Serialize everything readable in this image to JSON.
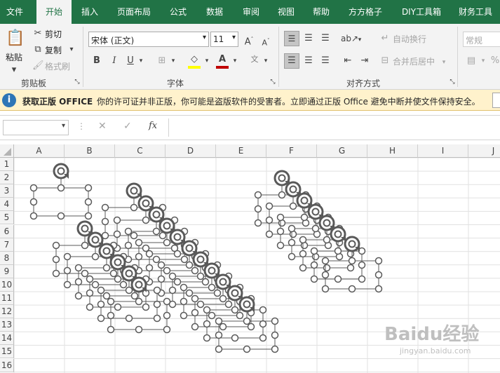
{
  "tabs": [
    "文件",
    "开始",
    "插入",
    "页面布局",
    "公式",
    "数据",
    "审阅",
    "视图",
    "帮助",
    "方方格子",
    "DIY工具箱",
    "财务工具"
  ],
  "active_tab": "开始",
  "clipboard": {
    "paste": "粘贴",
    "cut": "剪切",
    "copy": "复制",
    "format_painter": "格式刷",
    "group_label": "剪贴板"
  },
  "font": {
    "name": "宋体 (正文)",
    "size": "11",
    "bold": "B",
    "italic": "I",
    "underline": "U",
    "group_label": "字体",
    "font_color": "#c00000",
    "fill_color": "#ffff00"
  },
  "alignment": {
    "wrap": "自动换行",
    "merge": "合并后居中",
    "group_label": "对齐方式"
  },
  "number": {
    "format": "常规"
  },
  "message_bar": {
    "title": "获取正版 OFFICE",
    "text": "你的许可证并非正版，你可能是盗版软件的受害者。立即通过正版 Office 避免中断并使文件保持安全。"
  },
  "formula_bar": {
    "name_box": "",
    "fx": "fx",
    "cancel": "✕",
    "enter": "✓",
    "formula": ""
  },
  "columns": [
    "A",
    "B",
    "C",
    "D",
    "E",
    "F",
    "G",
    "H",
    "I",
    "J"
  ],
  "rows": [
    "1",
    "2",
    "3",
    "4",
    "5",
    "6",
    "7",
    "8",
    "9",
    "10",
    "11",
    "12",
    "13",
    "14",
    "15",
    "16"
  ],
  "watermark": {
    "text": "Baidu经验",
    "sub": "jingyan.baidu.com"
  },
  "colors": {
    "accent": "#217346",
    "shape_stroke": "#595959"
  }
}
